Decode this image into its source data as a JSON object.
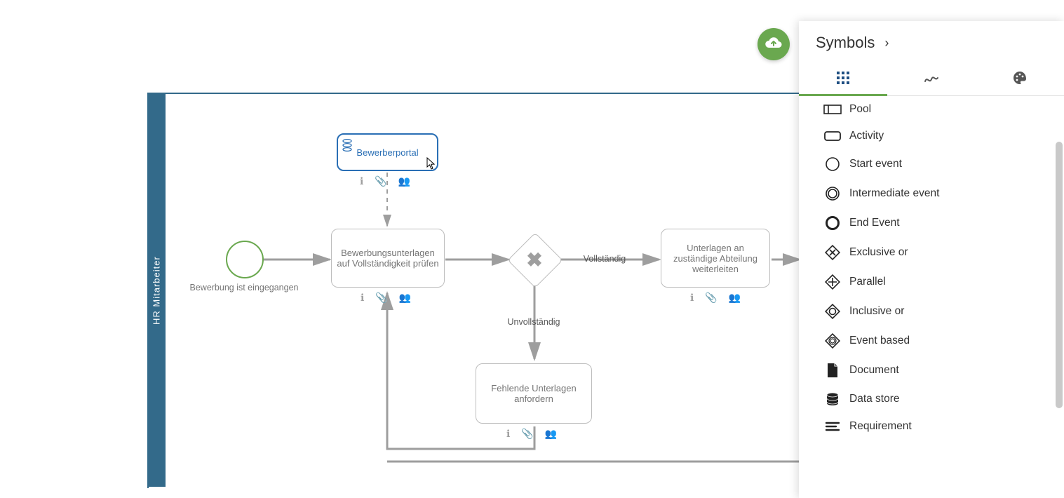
{
  "pool": {
    "laneLabel": "HR Mitarbeiter"
  },
  "nodes": {
    "startEventLabel": "Bewerbung ist eingegangen",
    "bewerberportal": "Bewerberportal",
    "pruefen": "Bewerbungsunterlagen auf Vollständigkeit prüfen",
    "vollstaendig": "Vollständig",
    "unvollstaendig": "Unvollständig",
    "weiterleiten": "Unterlagen an zuständige Abteilung weiterleiten",
    "anfordern": "Fehlende Unterlagen anfordern"
  },
  "panel": {
    "title": "Symbols",
    "items": [
      "Pool",
      "Activity",
      "Start event",
      "Intermediate event",
      "End Event",
      "Exclusive or",
      "Parallel",
      "Inclusive or",
      "Event based",
      "Document",
      "Data store",
      "Requirement"
    ]
  }
}
